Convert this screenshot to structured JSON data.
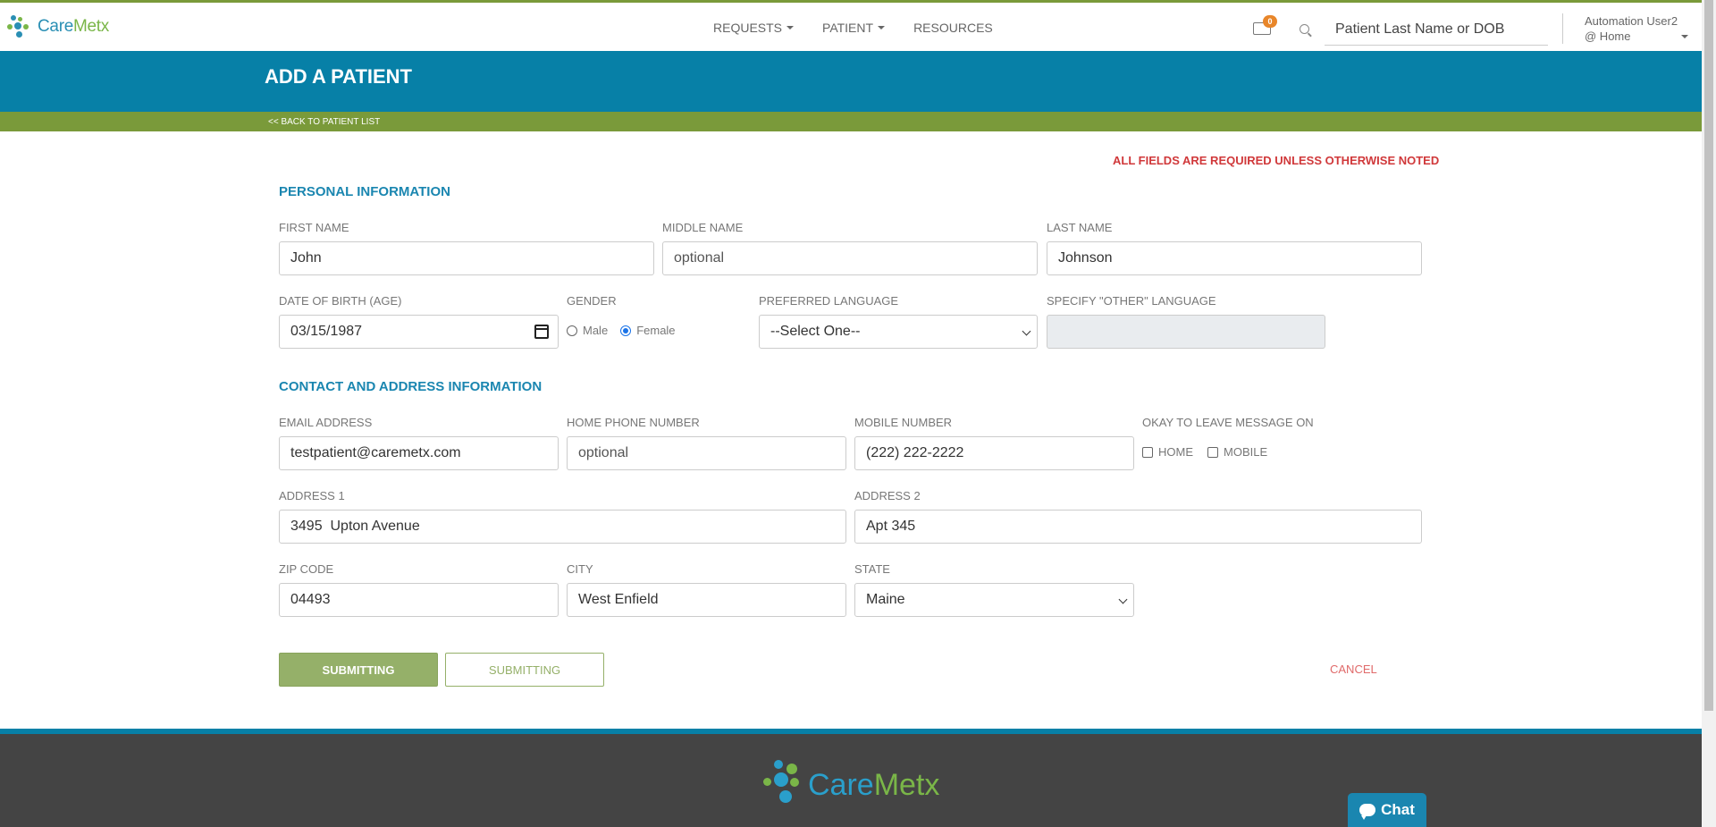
{
  "header": {
    "logo_text_1": "Care",
    "logo_text_2": "Metx",
    "nav": [
      {
        "label": "REQUESTS",
        "dropdown": true
      },
      {
        "label": "PATIENT",
        "dropdown": true
      },
      {
        "label": "RESOURCES",
        "dropdown": false
      }
    ],
    "mail_badge": "0",
    "search_placeholder": "Patient Last Name or DOB",
    "user_name": "Automation User2",
    "user_location": "@ Home"
  },
  "banner": {
    "title": "ADD A PATIENT",
    "back_link": "<< BACK TO PATIENT LIST"
  },
  "form": {
    "required_note": "ALL FIELDS ARE REQUIRED UNLESS OTHERWISE NOTED",
    "personal_title": "PERSONAL INFORMATION",
    "first_name": {
      "label": "FIRST NAME",
      "value": "John"
    },
    "middle_name": {
      "label": "MIDDLE NAME",
      "placeholder": "optional"
    },
    "last_name": {
      "label": "LAST NAME",
      "value": "Johnson"
    },
    "dob": {
      "label": "DATE OF BIRTH (AGE)",
      "value": "03/15/1987"
    },
    "gender": {
      "label": "GENDER",
      "options": [
        "Male",
        "Female"
      ],
      "selected": "Female"
    },
    "language": {
      "label": "PREFERRED LANGUAGE",
      "value": "--Select One--"
    },
    "other_language": {
      "label": "SPECIFY \"OTHER\" LANGUAGE"
    },
    "contact_title": "CONTACT AND ADDRESS INFORMATION",
    "email": {
      "label": "EMAIL ADDRESS",
      "value": "testpatient@caremetx.com"
    },
    "home_phone": {
      "label": "HOME PHONE NUMBER",
      "placeholder": "optional"
    },
    "mobile": {
      "label": "MOBILE NUMBER",
      "value": "(222) 222-2222"
    },
    "message_ok": {
      "label": "OKAY TO LEAVE MESSAGE ON",
      "home": "HOME",
      "mobile": "MOBILE"
    },
    "address1": {
      "label": "ADDRESS 1",
      "value": "3495  Upton Avenue"
    },
    "address2": {
      "label": "ADDRESS 2",
      "value": "Apt 345"
    },
    "zip": {
      "label": "ZIP CODE",
      "value": "04493"
    },
    "city": {
      "label": "CITY",
      "value": "West Enfield"
    },
    "state": {
      "label": "STATE",
      "value": "Maine"
    },
    "submit_primary": "SUBMITTING",
    "submit_secondary": "SUBMITTING",
    "cancel": "CANCEL"
  },
  "footer": {
    "logo_text_1": "Care",
    "logo_text_2": "Metx",
    "chat_label": "Chat"
  },
  "colors": {
    "brand_blue": "#0780a7",
    "brand_green": "#7a9a3a",
    "required_red": "#d0383a",
    "button_green": "#95b069"
  }
}
